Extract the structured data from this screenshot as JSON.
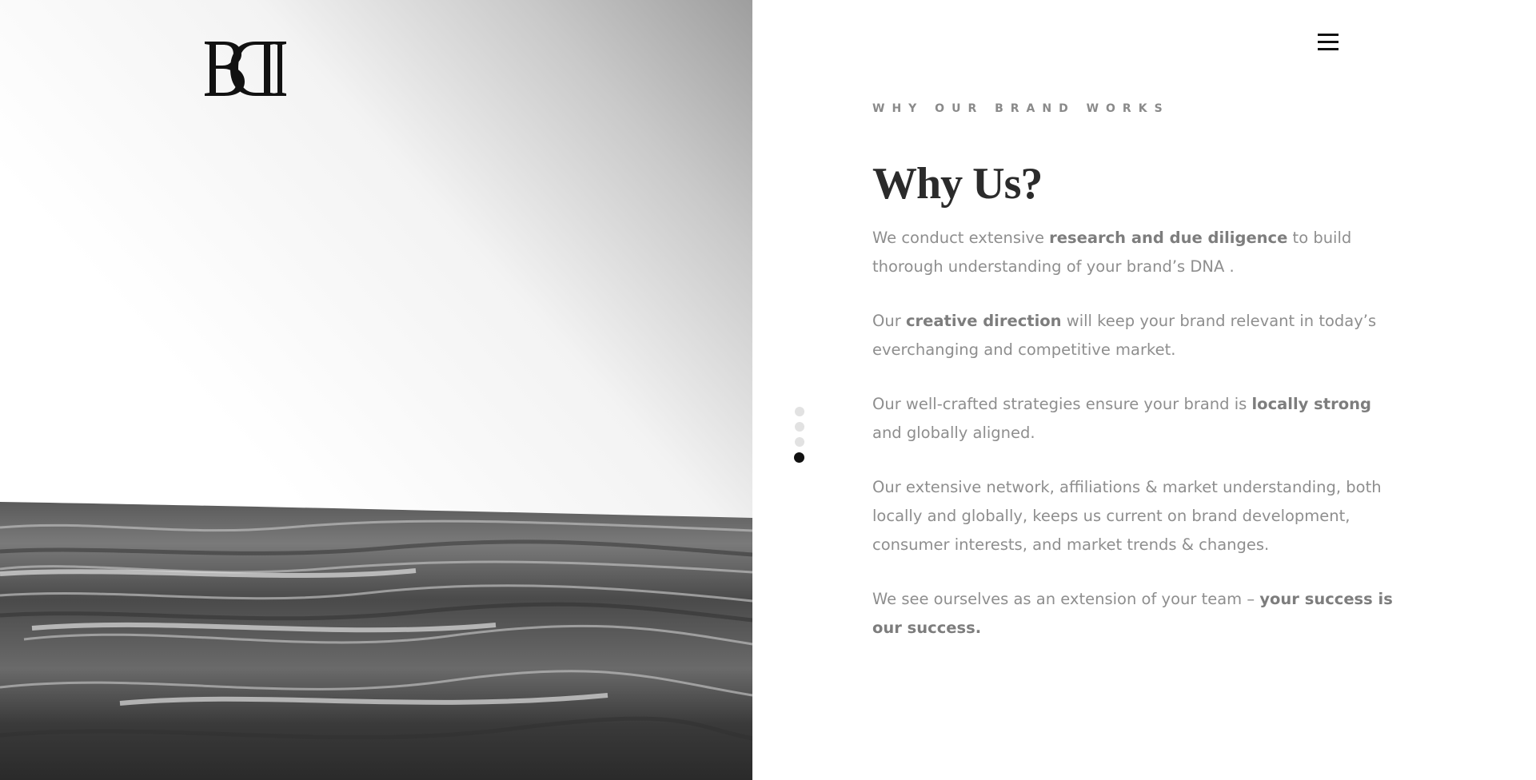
{
  "brand": {
    "logo_text": "BDI",
    "logo_icon": "bdi-monogram-logo"
  },
  "header": {
    "menu_icon": "hamburger-menu-icon"
  },
  "hero": {
    "image": "black-and-white ocean waves"
  },
  "pager": {
    "total": 4,
    "active_index": 3
  },
  "section": {
    "eyebrow": "WHY OUR BRAND WORKS",
    "title": "Why Us?",
    "paragraphs": [
      {
        "before": "We conduct extensive ",
        "bold": "research and due diligence",
        "after": " to build thorough understanding of your brand’s DNA ."
      },
      {
        "before": "Our ",
        "bold": "creative direction",
        "after": " will keep your brand relevant in today’s everchanging and competitive market."
      },
      {
        "before": "Our well-crafted strategies ensure your brand is ",
        "bold": "locally strong",
        "after": " and globally aligned."
      },
      {
        "text": "Our extensive network, affiliations & market understanding, both locally and globally, keeps us current on brand development, consumer interests, and market trends & changes."
      },
      {
        "before": "We see ourselves as an extension of your team – ",
        "bold": "your success is our success.",
        "after": ""
      }
    ]
  },
  "colors": {
    "text": "#8e8e8e",
    "heading": "#2b2b2b",
    "eyebrow": "#8a8a8a",
    "dot_inactive": "#e2e2e2",
    "dot_active": "#111111"
  }
}
